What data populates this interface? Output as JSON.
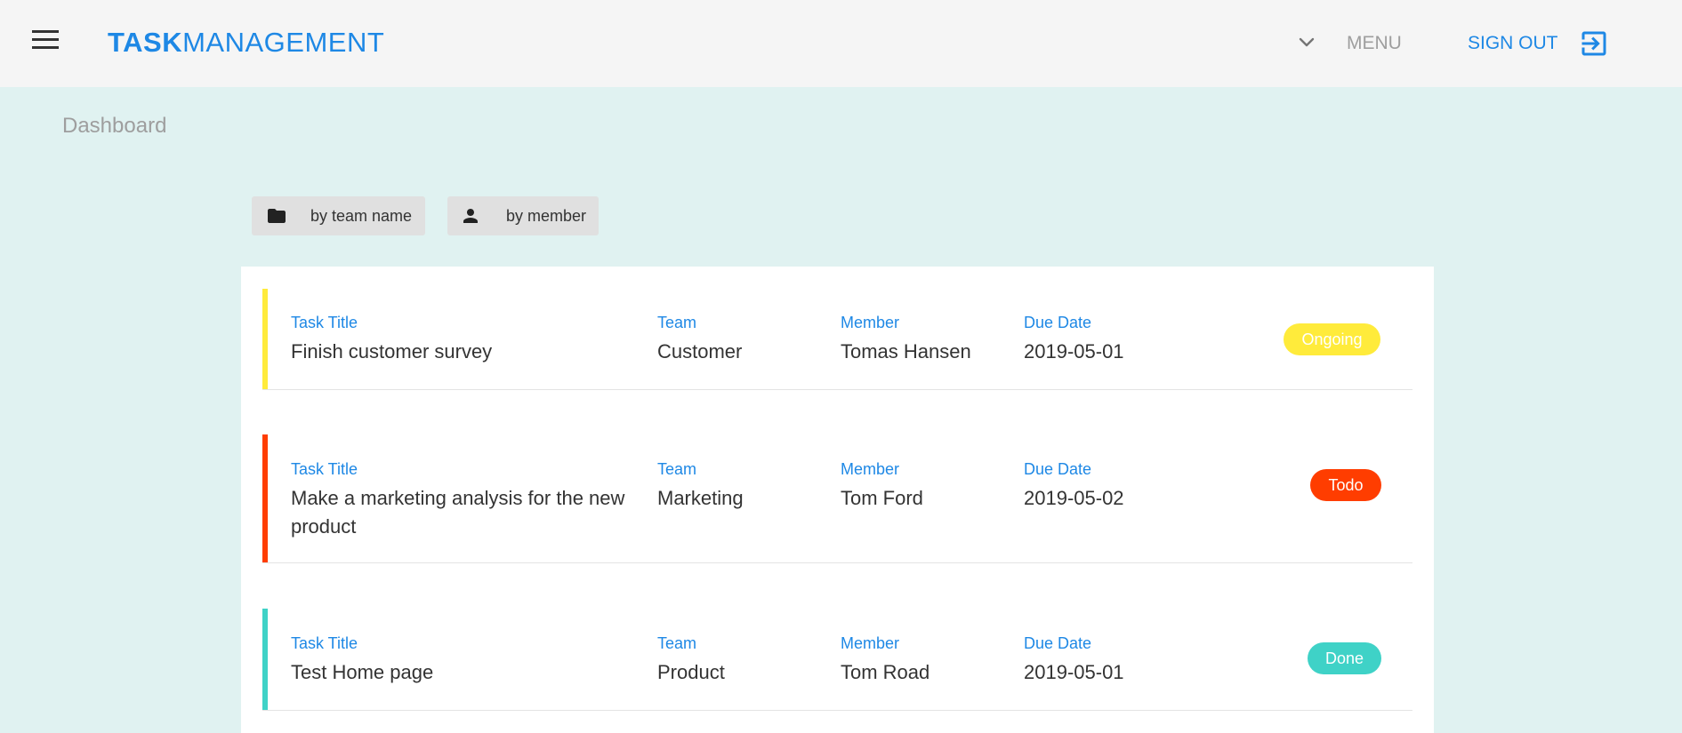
{
  "header": {
    "brand_bold": "TASK",
    "brand_light": "MANAGEMENT",
    "menu_label": "MENU",
    "signout_label": "SIGN OUT"
  },
  "page": {
    "title": "Dashboard"
  },
  "filters": {
    "team_label": "by team name",
    "member_label": "by member"
  },
  "columns": {
    "title": "Task Title",
    "team": "Team",
    "member": "Member",
    "due": "Due Date"
  },
  "tasks": [
    {
      "title": "Finish customer survey",
      "team": "Customer",
      "member": "Tomas Hansen",
      "due": "2019-05-01",
      "status": "Ongoing",
      "color": "#ffeb3b"
    },
    {
      "title": "Make a marketing analysis for the new product",
      "team": "Marketing",
      "member": "Tom Ford",
      "due": "2019-05-02",
      "status": "Todo",
      "color": "#ff3d00"
    },
    {
      "title": "Test Home page",
      "team": "Product",
      "member": "Tom Road",
      "due": "2019-05-01",
      "status": "Done",
      "color": "#3fd2c7"
    }
  ],
  "icons": {
    "menu": "hamburger-icon",
    "chevron": "chevron-down-icon",
    "signout": "exit-to-app-icon",
    "folder": "folder-icon",
    "person": "person-icon"
  },
  "colors": {
    "primary": "#1e88e5",
    "background": "#e0f2f1",
    "topbar": "#f5f5f5"
  }
}
